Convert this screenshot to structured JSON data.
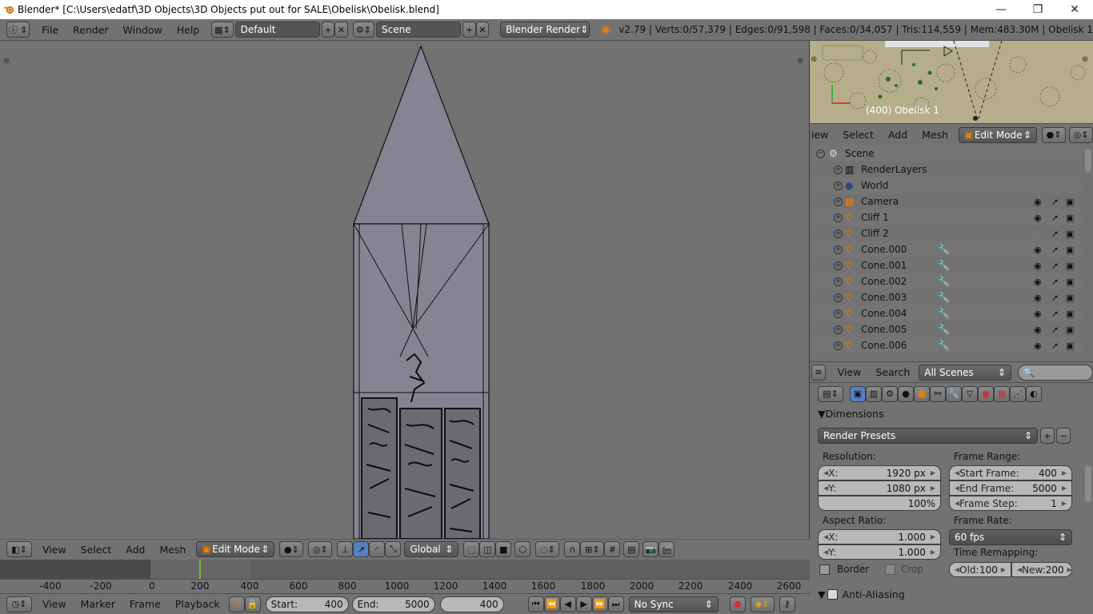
{
  "window": {
    "title": "Blender* [C:\\Users\\edatf\\3D Objects\\3D Objects put out for SALE\\Obelisk\\Obelisk.blend]",
    "minimize": "—",
    "restore": "❐",
    "close": "✕"
  },
  "info": {
    "menus": [
      "File",
      "Render",
      "Window",
      "Help"
    ],
    "layout": "Default",
    "scene": "Scene",
    "engine": "Blender Render",
    "stats": "v2.79 | Verts:0/57,379 | Edges:0/91,598 | Faces:0/34,057 | Tris:114,559 | Mem:483.30M | Obelisk 1"
  },
  "viewport_header": {
    "menus": [
      "View",
      "Select",
      "Add",
      "Mesh"
    ],
    "mode": "Edit Mode",
    "orientation": "Global"
  },
  "timeline": {
    "ruler": [
      "-400",
      "-200",
      "0",
      "200",
      "400",
      "600",
      "800",
      "1000",
      "1200",
      "1400",
      "1600",
      "1800",
      "2000",
      "2200",
      "2400",
      "2600"
    ],
    "menus": [
      "View",
      "Marker",
      "Frame",
      "Playback"
    ],
    "start_label": "Start:",
    "start": "400",
    "end_label": "End:",
    "end": "5000",
    "current": "400",
    "sync": "No Sync"
  },
  "camera_view": {
    "label": "(400) Obelisk 1"
  },
  "outliner_header": {
    "menus": [
      "iew",
      "Select",
      "Add",
      "Mesh"
    ],
    "mode": "Edit Mode"
  },
  "outliner": {
    "rows": [
      {
        "name": "Scene",
        "type": "scene"
      },
      {
        "name": "RenderLayers",
        "type": "renderlayers"
      },
      {
        "name": "World",
        "type": "world"
      },
      {
        "name": "Camera",
        "type": "camera"
      },
      {
        "name": "Cliff 1",
        "type": "mesh"
      },
      {
        "name": "Cliff 2",
        "type": "mesh"
      },
      {
        "name": "Cone.000",
        "type": "mesh"
      },
      {
        "name": "Cone.001",
        "type": "mesh"
      },
      {
        "name": "Cone.002",
        "type": "mesh"
      },
      {
        "name": "Cone.003",
        "type": "mesh"
      },
      {
        "name": "Cone.004",
        "type": "mesh"
      },
      {
        "name": "Cone.005",
        "type": "mesh"
      },
      {
        "name": "Cone.006",
        "type": "mesh"
      }
    ]
  },
  "search_header": {
    "menus": [
      "View",
      "Search"
    ],
    "filter": "All Scenes"
  },
  "properties": {
    "dimensions_label": "Dimensions",
    "render_presets": "Render Presets",
    "resolution_label": "Resolution:",
    "res_x_key": "X:",
    "res_x": "1920 px",
    "res_y_key": "Y:",
    "res_y": "1080 px",
    "res_pct": "100%",
    "frame_range_label": "Frame Range:",
    "start_frame_key": "Start Frame:",
    "start_frame": "400",
    "end_frame_key": "End Frame:",
    "end_frame": "5000",
    "frame_step_key": "Frame Step:",
    "frame_step": "1",
    "aspect_label": "Aspect Ratio:",
    "aspect_x_key": "X:",
    "aspect_x": "1.000",
    "aspect_y_key": "Y:",
    "aspect_y": "1.000",
    "frame_rate_label": "Frame Rate:",
    "frame_rate": "60 fps",
    "time_remap_label": "Time Remapping:",
    "border_label": "Border",
    "crop_label": "Crop",
    "old_key": "Old:",
    "old": "100",
    "new_key": "New:",
    "new": "200",
    "antialiasing_label": "Anti-Aliasing"
  }
}
